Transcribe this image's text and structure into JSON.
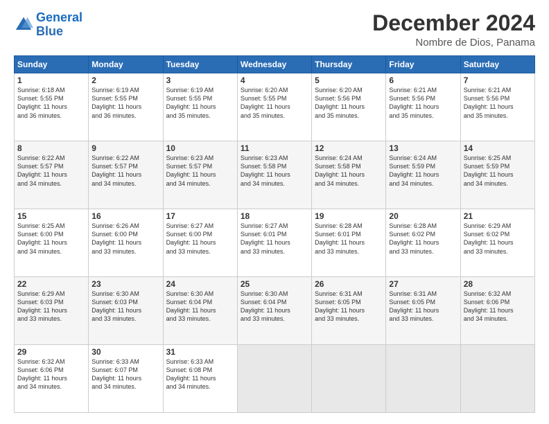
{
  "logo": {
    "line1": "General",
    "line2": "Blue"
  },
  "title": "December 2024",
  "subtitle": "Nombre de Dios, Panama",
  "days_header": [
    "Sunday",
    "Monday",
    "Tuesday",
    "Wednesday",
    "Thursday",
    "Friday",
    "Saturday"
  ],
  "weeks": [
    [
      {
        "num": "1",
        "info": "Sunrise: 6:18 AM\nSunset: 5:55 PM\nDaylight: 11 hours\nand 36 minutes."
      },
      {
        "num": "2",
        "info": "Sunrise: 6:19 AM\nSunset: 5:55 PM\nDaylight: 11 hours\nand 36 minutes."
      },
      {
        "num": "3",
        "info": "Sunrise: 6:19 AM\nSunset: 5:55 PM\nDaylight: 11 hours\nand 35 minutes."
      },
      {
        "num": "4",
        "info": "Sunrise: 6:20 AM\nSunset: 5:55 PM\nDaylight: 11 hours\nand 35 minutes."
      },
      {
        "num": "5",
        "info": "Sunrise: 6:20 AM\nSunset: 5:56 PM\nDaylight: 11 hours\nand 35 minutes."
      },
      {
        "num": "6",
        "info": "Sunrise: 6:21 AM\nSunset: 5:56 PM\nDaylight: 11 hours\nand 35 minutes."
      },
      {
        "num": "7",
        "info": "Sunrise: 6:21 AM\nSunset: 5:56 PM\nDaylight: 11 hours\nand 35 minutes."
      }
    ],
    [
      {
        "num": "8",
        "info": "Sunrise: 6:22 AM\nSunset: 5:57 PM\nDaylight: 11 hours\nand 34 minutes."
      },
      {
        "num": "9",
        "info": "Sunrise: 6:22 AM\nSunset: 5:57 PM\nDaylight: 11 hours\nand 34 minutes."
      },
      {
        "num": "10",
        "info": "Sunrise: 6:23 AM\nSunset: 5:57 PM\nDaylight: 11 hours\nand 34 minutes."
      },
      {
        "num": "11",
        "info": "Sunrise: 6:23 AM\nSunset: 5:58 PM\nDaylight: 11 hours\nand 34 minutes."
      },
      {
        "num": "12",
        "info": "Sunrise: 6:24 AM\nSunset: 5:58 PM\nDaylight: 11 hours\nand 34 minutes."
      },
      {
        "num": "13",
        "info": "Sunrise: 6:24 AM\nSunset: 5:59 PM\nDaylight: 11 hours\nand 34 minutes."
      },
      {
        "num": "14",
        "info": "Sunrise: 6:25 AM\nSunset: 5:59 PM\nDaylight: 11 hours\nand 34 minutes."
      }
    ],
    [
      {
        "num": "15",
        "info": "Sunrise: 6:25 AM\nSunset: 6:00 PM\nDaylight: 11 hours\nand 34 minutes."
      },
      {
        "num": "16",
        "info": "Sunrise: 6:26 AM\nSunset: 6:00 PM\nDaylight: 11 hours\nand 33 minutes."
      },
      {
        "num": "17",
        "info": "Sunrise: 6:27 AM\nSunset: 6:00 PM\nDaylight: 11 hours\nand 33 minutes."
      },
      {
        "num": "18",
        "info": "Sunrise: 6:27 AM\nSunset: 6:01 PM\nDaylight: 11 hours\nand 33 minutes."
      },
      {
        "num": "19",
        "info": "Sunrise: 6:28 AM\nSunset: 6:01 PM\nDaylight: 11 hours\nand 33 minutes."
      },
      {
        "num": "20",
        "info": "Sunrise: 6:28 AM\nSunset: 6:02 PM\nDaylight: 11 hours\nand 33 minutes."
      },
      {
        "num": "21",
        "info": "Sunrise: 6:29 AM\nSunset: 6:02 PM\nDaylight: 11 hours\nand 33 minutes."
      }
    ],
    [
      {
        "num": "22",
        "info": "Sunrise: 6:29 AM\nSunset: 6:03 PM\nDaylight: 11 hours\nand 33 minutes."
      },
      {
        "num": "23",
        "info": "Sunrise: 6:30 AM\nSunset: 6:03 PM\nDaylight: 11 hours\nand 33 minutes."
      },
      {
        "num": "24",
        "info": "Sunrise: 6:30 AM\nSunset: 6:04 PM\nDaylight: 11 hours\nand 33 minutes."
      },
      {
        "num": "25",
        "info": "Sunrise: 6:30 AM\nSunset: 6:04 PM\nDaylight: 11 hours\nand 33 minutes."
      },
      {
        "num": "26",
        "info": "Sunrise: 6:31 AM\nSunset: 6:05 PM\nDaylight: 11 hours\nand 33 minutes."
      },
      {
        "num": "27",
        "info": "Sunrise: 6:31 AM\nSunset: 6:05 PM\nDaylight: 11 hours\nand 33 minutes."
      },
      {
        "num": "28",
        "info": "Sunrise: 6:32 AM\nSunset: 6:06 PM\nDaylight: 11 hours\nand 34 minutes."
      }
    ],
    [
      {
        "num": "29",
        "info": "Sunrise: 6:32 AM\nSunset: 6:06 PM\nDaylight: 11 hours\nand 34 minutes."
      },
      {
        "num": "30",
        "info": "Sunrise: 6:33 AM\nSunset: 6:07 PM\nDaylight: 11 hours\nand 34 minutes."
      },
      {
        "num": "31",
        "info": "Sunrise: 6:33 AM\nSunset: 6:08 PM\nDaylight: 11 hours\nand 34 minutes."
      },
      {
        "num": "",
        "info": ""
      },
      {
        "num": "",
        "info": ""
      },
      {
        "num": "",
        "info": ""
      },
      {
        "num": "",
        "info": ""
      }
    ]
  ]
}
